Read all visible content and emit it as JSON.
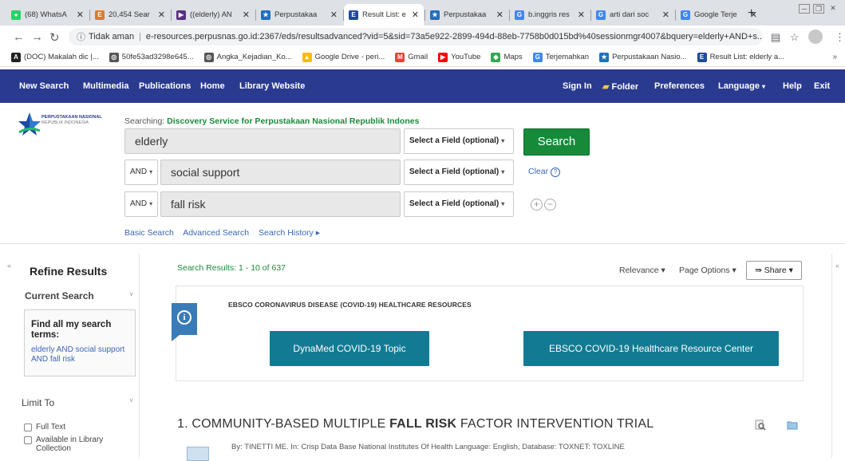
{
  "browser": {
    "tabs": [
      {
        "title": "(68) WhatsA",
        "favicon": "whatsapp-icon",
        "color": "#25d366",
        "glyph": "●"
      },
      {
        "title": "20,454 Sear",
        "favicon": "e-icon",
        "color": "#e07a2c",
        "glyph": "E"
      },
      {
        "title": "((elderly) AN",
        "favicon": "ebsco-icon",
        "color": "#5a2d82",
        "glyph": "▶"
      },
      {
        "title": "Perpustakaa",
        "favicon": "star-icon",
        "color": "#1f6fbf",
        "glyph": "★"
      },
      {
        "title": "Result List: e",
        "favicon": "ebsco-icon",
        "color": "#1f4aa0",
        "glyph": "E",
        "active": true
      },
      {
        "title": "Perpustakaa",
        "favicon": "star-icon",
        "color": "#1f6fbf",
        "glyph": "★"
      },
      {
        "title": "b.inggris res",
        "favicon": "google-icon",
        "color": "#4285f4",
        "glyph": "G"
      },
      {
        "title": "arti dari soc",
        "favicon": "google-icon",
        "color": "#4285f4",
        "glyph": "G"
      },
      {
        "title": "Google Terje",
        "favicon": "translate-icon",
        "color": "#4285f4",
        "glyph": "G"
      }
    ],
    "new_tab": "+",
    "security": "Tidak aman",
    "url": "e-resources.perpusnas.go.id:2367/eds/resultsadvanced?vid=5&sid=73a5e922-2899-494d-88eb-7758b0d015bd%40sessionmgr4007&bquery=elderly+AND+s..."
  },
  "bookmarks": [
    {
      "label": "(DOC) Makalah dic |...",
      "icon": "a-icon",
      "color": "#222",
      "glyph": "A"
    },
    {
      "label": "50fe53ad3298e645...",
      "icon": "globe-icon",
      "color": "#555",
      "glyph": "◎"
    },
    {
      "label": "Angka_Kejadian_Ko...",
      "icon": "globe-icon",
      "color": "#555",
      "glyph": "◎"
    },
    {
      "label": "Google Drive - peri...",
      "icon": "drive-icon",
      "color": "#fbbc04",
      "glyph": "▲"
    },
    {
      "label": "Gmail",
      "icon": "gmail-icon",
      "color": "#ea4335",
      "glyph": "M"
    },
    {
      "label": "YouTube",
      "icon": "youtube-icon",
      "color": "#ff0000",
      "glyph": "▶"
    },
    {
      "label": "Maps",
      "icon": "maps-icon",
      "color": "#34a853",
      "glyph": "◆"
    },
    {
      "label": "Terjemahkan",
      "icon": "translate-icon",
      "color": "#4285f4",
      "glyph": "G"
    },
    {
      "label": "Perpustakaan Nasio...",
      "icon": "star-icon",
      "color": "#1f6fbf",
      "glyph": "★"
    },
    {
      "label": "Result List: elderly a...",
      "icon": "ebsco-icon",
      "color": "#1f4aa0",
      "glyph": "E"
    }
  ],
  "toolbar": {
    "new_search": "New Search",
    "multimedia": "Multimedia",
    "publications": "Publications",
    "home": "Home",
    "library_website": "Library Website",
    "sign_in": "Sign In",
    "folder": "Folder",
    "preferences": "Preferences",
    "language": "Language",
    "help": "Help",
    "exit": "Exit"
  },
  "logo": {
    "line1": "PERPUSTAKAAN NASIONAL",
    "line2": "REPUBLIK INDONESIA"
  },
  "search": {
    "searching_label": "Searching:",
    "searching_target": "Discovery Service for Perpustakaan Nasional Republik Indones",
    "rows": [
      {
        "term": "elderly",
        "field": "Select a Field (optional)"
      },
      {
        "bool": "AND",
        "term": "social support",
        "field": "Select a Field (optional)"
      },
      {
        "bool": "AND",
        "term": "fall risk",
        "field": "Select a Field (optional)"
      }
    ],
    "button": "Search",
    "clear": "Clear",
    "links": [
      "Basic Search",
      "Advanced Search",
      "Search History ▸"
    ]
  },
  "refine": {
    "title": "Refine Results",
    "current_search": "Current Search",
    "find_all": "Find all my search terms:",
    "query": "elderly AND social support AND fall risk",
    "limit_to": "Limit To",
    "checkboxes": [
      "Full Text",
      "Available in Library Collection"
    ]
  },
  "results": {
    "count_text": "Search Results: 1 - 10 of 637",
    "relevance": "Relevance ▾",
    "page_options": "Page Options ▾",
    "share": "Share ▾",
    "promo_title": "EBSCO CORONAVIRUS DISEASE (COVID-19) HEALTHCARE RESOURCES",
    "promo_btn1": "DynaMed COVID-19 Topic",
    "promo_btn2": "EBSCO COVID-19 Healthcare Resource Center",
    "item1_prefix": "1. COMMUNITY-BASED MULTIPLE ",
    "item1_bold": "FALL RISK",
    "item1_suffix": " FACTOR INTERVENTION TRIAL",
    "item1_meta": "By: TINETTI ME. In: Crisp Data Base National Institutes Of Health Language: English, Database: TOXNET: TOXLINE"
  }
}
